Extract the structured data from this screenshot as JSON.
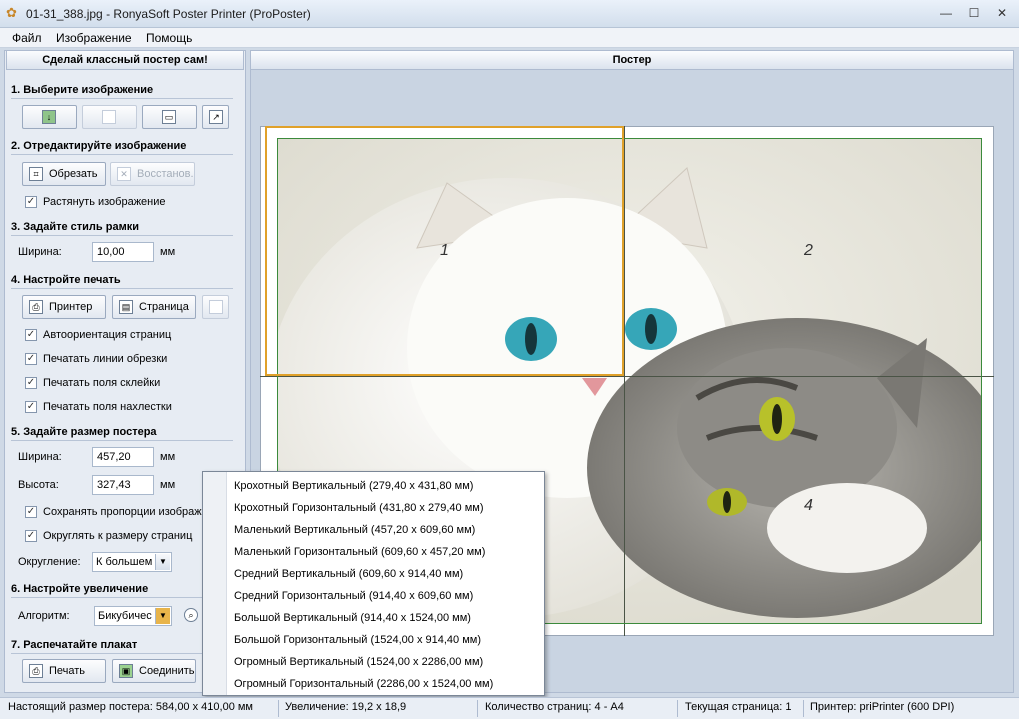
{
  "window": {
    "title": "01-31_388.jpg - RonyaSoft Poster Printer (ProPoster)"
  },
  "menu": [
    "Файл",
    "Изображение",
    "Помощь"
  ],
  "left_panel": {
    "header": "Сделай классный постер сам!",
    "s1": {
      "title": "1. Выберите изображение"
    },
    "s2": {
      "title": "2. Отредактируйте изображение",
      "crop": "Обрезать",
      "restore": "Восстанов.",
      "stretch": "Растянуть изображение"
    },
    "s3": {
      "title": "3. Задайте стиль рамки",
      "width_label": "Ширина:",
      "width_value": "10,00",
      "unit": "мм"
    },
    "s4": {
      "title": "4. Настройте печать",
      "printer": "Принтер",
      "page": "Страница",
      "checks": [
        "Автоориентация страниц",
        "Печатать линии обрезки",
        "Печатать поля склейки",
        "Печатать поля нахлестки"
      ]
    },
    "s5": {
      "title": "5. Задайте размер постера",
      "width_label": "Ширина:",
      "width_value": "457,20",
      "height_label": "Высота:",
      "height_value": "327,43",
      "unit": "мм",
      "keep_ratio": "Сохранять пропорции изображ",
      "round_page": "Округлять к размеру страниц",
      "round_label": "Округление:",
      "round_value": "К большем"
    },
    "s6": {
      "title": "6. Настройте увеличение",
      "algo_label": "Алгоритм:",
      "algo_value": "Бикубичес"
    },
    "s7": {
      "title": "7. Распечатайте плакат",
      "print": "Печать",
      "join": "Соединить"
    }
  },
  "right_panel": {
    "header": "Постер",
    "page_numbers": [
      "1",
      "2",
      "4"
    ]
  },
  "dropdown_items": [
    "Крохотный Вертикальный (279,40 x 431,80 мм)",
    "Крохотный Горизонтальный (431,80 x 279,40 мм)",
    "Маленький Вертикальный (457,20 x 609,60 мм)",
    "Маленький Горизонтальный (609,60 x 457,20 мм)",
    "Средний Вертикальный (609,60 x 914,40 мм)",
    "Средний Горизонтальный (914,40 x 609,60 мм)",
    "Большой Вертикальный (914,40 x 1524,00 мм)",
    "Большой Горизонтальный (1524,00 x 914,40 мм)",
    "Огромный Вертикальный (1524,00 x 2286,00 мм)",
    "Огромный Горизонтальный (2286,00 x 1524,00 мм)"
  ],
  "status": {
    "size": "Настоящий размер постера: 584,00 x 410,00 мм",
    "zoom": "Увеличение: 19,2 x 18,9",
    "pages": "Количество страниц: 4 - A4",
    "current": "Текущая страница: 1",
    "printer": "Принтер: priPrinter (600 DPI)"
  },
  "colors": {
    "accent": "#e0a12a",
    "green_margin": "#3b8a3b"
  }
}
